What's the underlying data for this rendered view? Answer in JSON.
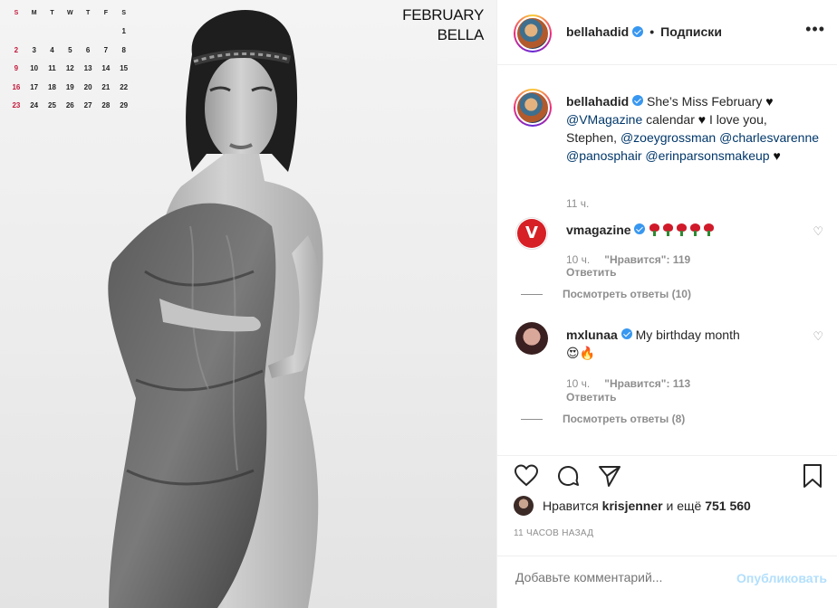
{
  "photo": {
    "calendar": {
      "headers": [
        "S",
        "M",
        "T",
        "W",
        "T",
        "F",
        "S"
      ],
      "weeks": [
        [
          "",
          "",
          "",
          "",
          "",
          "",
          "1"
        ],
        [
          "2",
          "3",
          "4",
          "5",
          "6",
          "7",
          "8"
        ],
        [
          "9",
          "10",
          "11",
          "12",
          "13",
          "14",
          "15"
        ],
        [
          "16",
          "17",
          "18",
          "19",
          "20",
          "21",
          "22"
        ],
        [
          "23",
          "24",
          "25",
          "26",
          "27",
          "28",
          "29"
        ]
      ],
      "sunday_color": "#c2183a"
    },
    "month": "FEBRUARY",
    "name": "BELLA"
  },
  "header": {
    "username": "bellahadid",
    "separator": "•",
    "follow_label": "Подписки",
    "more_label": "•••"
  },
  "caption": {
    "username": "bellahadid",
    "text_1": "She’s Miss February",
    "mention_1": "@VMagazine",
    "text_2": "calendar",
    "text_3": "I love you, Stephen,",
    "mention_2": "@zoeygrossman",
    "mention_3": "@charlesvarenne",
    "mention_4": "@panosphair",
    "mention_5": "@erinparsonsmakeup",
    "time": "11 ч."
  },
  "comments": [
    {
      "username": "vmagazine",
      "avatar_letter": "V",
      "text": "",
      "emoji": "rose x5",
      "time": "10 ч.",
      "likes": "\"Нравится\": 119",
      "reply": "Ответить",
      "view_replies": "Посмотреть ответы (10)"
    },
    {
      "username": "mxlunaa",
      "text": "My birthday month",
      "emoji_line": "😍🔥",
      "time": "10 ч.",
      "likes": "\"Нравится\": 113",
      "reply": "Ответить",
      "view_replies": "Посмотреть ответы (8)"
    }
  ],
  "likes": {
    "prefix": "Нравится",
    "user": "krisjenner",
    "middle": "и ещё",
    "count": "751 560"
  },
  "post_time": "11 ЧАСОВ НАЗАД",
  "comment_box": {
    "placeholder": "Добавьте комментарий...",
    "post_label": "Опубликовать"
  },
  "colors": {
    "verified": "#3897f0",
    "mention": "#00376b",
    "secondary_text": "#8e8e8e",
    "post_disabled": "#b2dffc"
  }
}
